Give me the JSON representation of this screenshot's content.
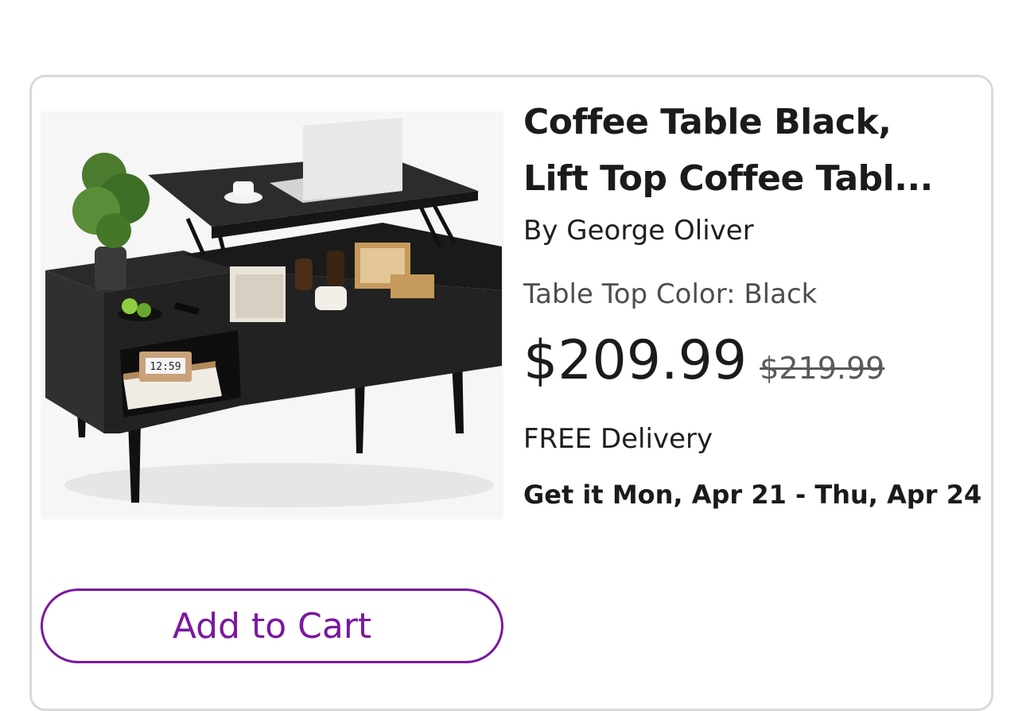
{
  "product": {
    "title_line1": "Coffee Table Black,",
    "title_line2": "Lift Top Coffee Tabl...",
    "brand": "By George Oliver",
    "option": "Table Top Color: Black",
    "price": "$209.99",
    "was_price": "$219.99",
    "delivery": "FREE Delivery",
    "eta": "Get it Mon, Apr 21 - Thu, Apr 24",
    "clock_text": "12:59"
  },
  "actions": {
    "add_to_cart_label": "Add to Cart"
  },
  "colors": {
    "accent": "#7b189f",
    "border": "#d9d9d9",
    "text": "#1b1b1b",
    "muted": "#4d4d4d"
  }
}
